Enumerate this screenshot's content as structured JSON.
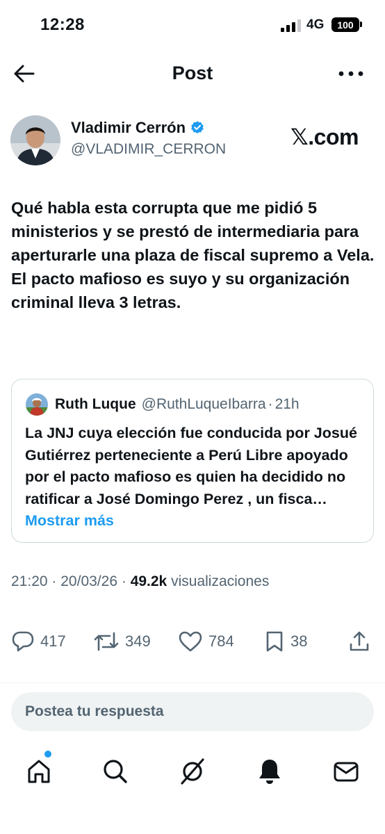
{
  "status_bar": {
    "time": "12:28",
    "network": "4G",
    "battery": "100"
  },
  "header": {
    "title": "Post",
    "back_icon": "arrow-left-icon",
    "more_icon": "more-horizontal-icon"
  },
  "author": {
    "name": "Vladimir Cerrón",
    "handle": "@VLADIMIR_CERRON",
    "verified_color": "#1d9bf0"
  },
  "source_logo": "𝕏.com",
  "tweet": {
    "text": "Qué habla esta corrupta que me pidió 5 ministerios y se prestó de intermediaria para aperturarle una plaza de fiscal supremo a Vela. El pacto mafioso es suyo y su organización criminal lleva 3 letras."
  },
  "quoted": {
    "name": "Ruth Luque",
    "handle": "@RuthLuqueIbarra",
    "dot": "·",
    "time": "21h",
    "text": "La JNJ cuya elección fue conducida por Josué Gutiérrez perteneciente a Perú Libre apoyado por el pacto mafioso es quien ha decidido no ratificar a José Domingo Perez , un fisca…",
    "show_more": "Mostrar más"
  },
  "meta": {
    "time": "21:20",
    "sep1": "·",
    "date": "20/03/26",
    "sep2": "·",
    "views_count": "49.2k",
    "views_label": "visualizaciones"
  },
  "actions": {
    "replies": "417",
    "reposts": "349",
    "likes": "784",
    "bookmarks": "38"
  },
  "reply": {
    "placeholder": "Postea tu respuesta"
  },
  "nav": {
    "items": [
      "home-icon",
      "search-icon",
      "grok-icon",
      "notifications-icon",
      "messages-icon"
    ]
  },
  "colors": {
    "accent": "#1d9bf0",
    "text": "#0f1419",
    "secondary": "#536471",
    "border": "#cfd9de"
  }
}
